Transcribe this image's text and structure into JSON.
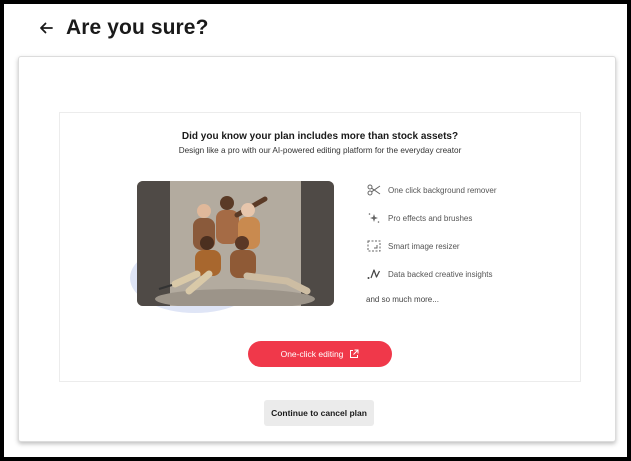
{
  "header": {
    "title": "Are you sure?"
  },
  "promo": {
    "headline": "Did you know your plan includes more than stock assets?",
    "subheadline": "Design like a pro with our AI-powered editing platform for the everyday creator",
    "features": [
      {
        "icon": "scissors-icon",
        "label": "One click background remover"
      },
      {
        "icon": "sparkle-icon",
        "label": "Pro effects and brushes"
      },
      {
        "icon": "resize-icon",
        "label": "Smart image resizer"
      },
      {
        "icon": "insights-icon",
        "label": "Data backed creative insights"
      }
    ],
    "more": "and so much more...",
    "cta_label": "One-click editing",
    "cta_icon": "external-link-icon"
  },
  "footer": {
    "cancel_label": "Continue to cancel plan"
  },
  "colors": {
    "accent": "#f0384a",
    "blob": "#dfe5f6",
    "cancel_bg": "#ebebeb"
  }
}
